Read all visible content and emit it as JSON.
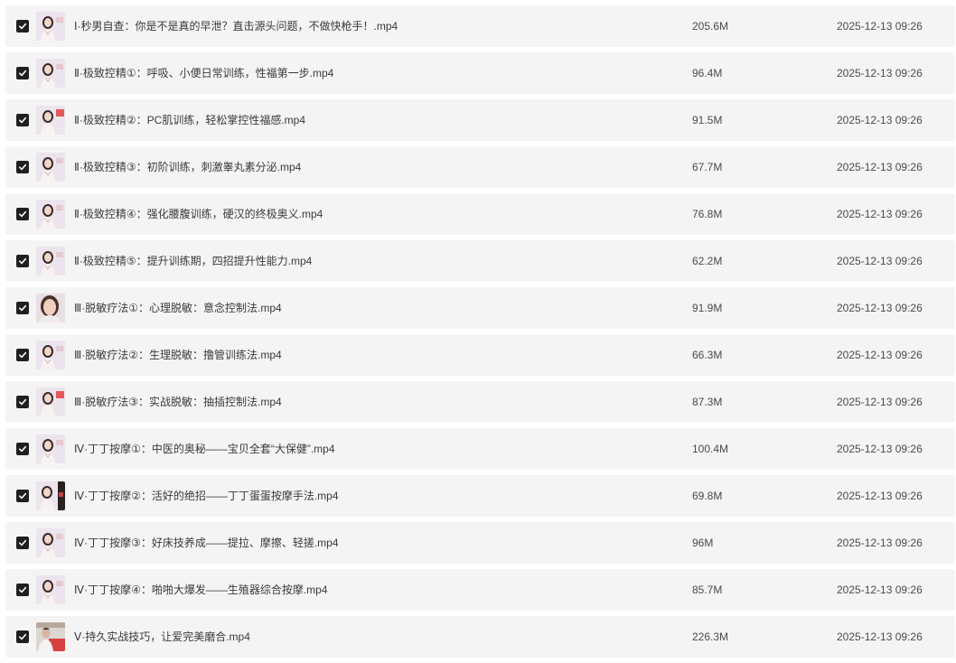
{
  "files": [
    {
      "name": "Ⅰ·秒男自查：你是不是真的早泄？直击源头问题，不做快枪手！.mp4",
      "size": "205.6M",
      "date": "2025-12-13 09:26",
      "checked": true,
      "thumb": "woman-lecturer"
    },
    {
      "name": "Ⅱ·极致控精①：呼吸、小便日常训练，性福第一步.mp4",
      "size": "96.4M",
      "date": "2025-12-13 09:26",
      "checked": true,
      "thumb": "woman-lecturer"
    },
    {
      "name": "Ⅱ·极致控精②：PC肌训练，轻松掌控性福感.mp4",
      "size": "91.5M",
      "date": "2025-12-13 09:26",
      "checked": true,
      "thumb": "woman-lecturer-red"
    },
    {
      "name": "Ⅱ·极致控精③：初阶训练，刺激睾丸素分泌.mp4",
      "size": "67.7M",
      "date": "2025-12-13 09:26",
      "checked": true,
      "thumb": "woman-lecturer"
    },
    {
      "name": "Ⅱ·极致控精④：强化腰腹训练，硬汉的终极奥义.mp4",
      "size": "76.8M",
      "date": "2025-12-13 09:26",
      "checked": true,
      "thumb": "woman-lecturer"
    },
    {
      "name": "Ⅱ·极致控精⑤：提升训练期，四招提升性能力.mp4",
      "size": "62.2M",
      "date": "2025-12-13 09:26",
      "checked": true,
      "thumb": "woman-lecturer"
    },
    {
      "name": "Ⅲ·脱敏疗法①：心理脱敏：意念控制法.mp4",
      "size": "91.9M",
      "date": "2025-12-13 09:26",
      "checked": true,
      "thumb": "woman-closeup"
    },
    {
      "name": "Ⅲ·脱敏疗法②：生理脱敏：撸管训练法.mp4",
      "size": "66.3M",
      "date": "2025-12-13 09:26",
      "checked": true,
      "thumb": "woman-lecturer"
    },
    {
      "name": "Ⅲ·脱敏疗法③：实战脱敏：抽插控制法.mp4",
      "size": "87.3M",
      "date": "2025-12-13 09:26",
      "checked": true,
      "thumb": "woman-lecturer-red"
    },
    {
      "name": "Ⅳ·丁丁按摩①：中医的奥秘——宝贝全套“大保健”.mp4",
      "size": "100.4M",
      "date": "2025-12-13 09:26",
      "checked": true,
      "thumb": "woman-lecturer"
    },
    {
      "name": "Ⅳ·丁丁按摩②：活好的绝招——丁丁蛋蛋按摩手法.mp4",
      "size": "69.8M",
      "date": "2025-12-13 09:26",
      "checked": true,
      "thumb": "woman-lecturer-dark"
    },
    {
      "name": "Ⅳ·丁丁按摩③：好床技养成——提拉、摩擦、轻搓.mp4",
      "size": "96M",
      "date": "2025-12-13 09:26",
      "checked": true,
      "thumb": "woman-lecturer"
    },
    {
      "name": "Ⅳ·丁丁按摩④：啪啪大爆发——生殖器综合按摩.mp4",
      "size": "85.7M",
      "date": "2025-12-13 09:26",
      "checked": true,
      "thumb": "woman-lecturer"
    },
    {
      "name": "Ⅴ·持久实战技巧，让爱完美磨合.mp4",
      "size": "226.3M",
      "date": "2025-12-13 09:26",
      "checked": true,
      "thumb": "man-lecturer-red"
    }
  ],
  "colors": {
    "row_bg": "#f4f4f4",
    "checkbox": "#1f1f1f",
    "text": "#3a3a3a"
  }
}
